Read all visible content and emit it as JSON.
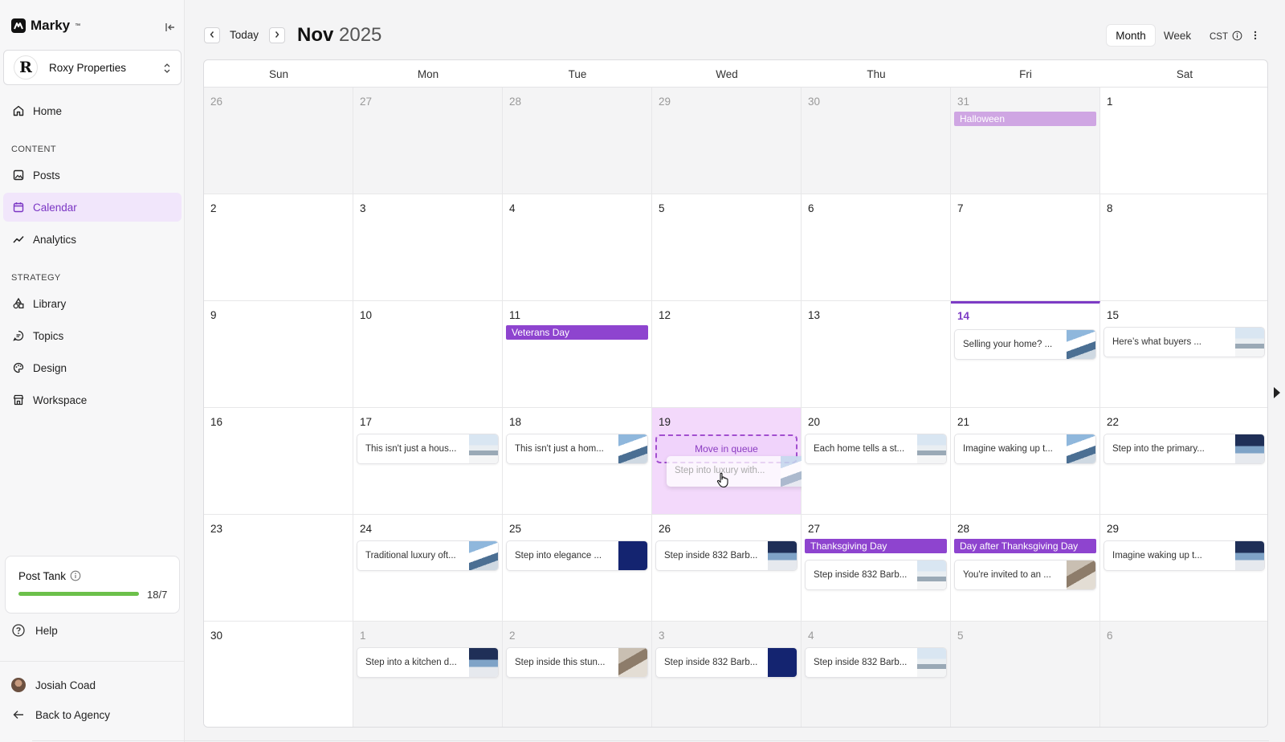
{
  "app": {
    "name": "Marky",
    "trademark": "™"
  },
  "brand": {
    "initial": "R",
    "name": "Roxy Properties"
  },
  "nav": {
    "home": "Home",
    "content_label": "CONTENT",
    "posts": "Posts",
    "calendar": "Calendar",
    "analytics": "Analytics",
    "strategy_label": "STRATEGY",
    "library": "Library",
    "topics": "Topics",
    "design": "Design",
    "workspace": "Workspace"
  },
  "post_tank": {
    "title": "Post Tank",
    "count": "18/7",
    "fill_fraction": 1.0
  },
  "footer": {
    "help": "Help",
    "user": "Josiah Coad",
    "back": "Back to Agency"
  },
  "header": {
    "today": "Today",
    "month": "Nov",
    "year": "2025",
    "view_month": "Month",
    "view_week": "Week",
    "timezone": "CST"
  },
  "colors": {
    "accent": "#7d3cc5",
    "holiday_light": "#cfa6e3",
    "holiday": "#8e44cf",
    "progress": "#6cc04a",
    "highlight": "#f3d9fb"
  },
  "calendar": {
    "weekdays": [
      "Sun",
      "Mon",
      "Tue",
      "Wed",
      "Thu",
      "Fri",
      "Sat"
    ],
    "weeks": [
      [
        {
          "d": "26",
          "out": true
        },
        {
          "d": "27",
          "out": true
        },
        {
          "d": "28",
          "out": true
        },
        {
          "d": "29",
          "out": true
        },
        {
          "d": "30",
          "out": true
        },
        {
          "d": "31",
          "out": true,
          "holiday": {
            "label": "Halloween",
            "style": "light"
          }
        },
        {
          "d": "1"
        }
      ],
      [
        {
          "d": "2"
        },
        {
          "d": "3"
        },
        {
          "d": "4"
        },
        {
          "d": "5"
        },
        {
          "d": "6"
        },
        {
          "d": "7"
        },
        {
          "d": "8"
        }
      ],
      [
        {
          "d": "9"
        },
        {
          "d": "10"
        },
        {
          "d": "11",
          "holiday": {
            "label": "Veterans Day",
            "style": "dark"
          }
        },
        {
          "d": "12"
        },
        {
          "d": "13"
        },
        {
          "d": "14",
          "today": true,
          "post": {
            "text": "Selling your home? ...",
            "thumb": "t2"
          }
        },
        {
          "d": "15",
          "post": {
            "text": "Here’s what buyers ...",
            "thumb": "t1"
          }
        }
      ],
      [
        {
          "d": "16"
        },
        {
          "d": "17",
          "post": {
            "text": "This isn't just a hous...",
            "thumb": "t1"
          }
        },
        {
          "d": "18",
          "post": {
            "text": "This isn't just a hom...",
            "thumb": "t2"
          }
        },
        {
          "d": "19",
          "highlight": true,
          "queue": "Move in queue",
          "ghost": {
            "text": "Step into luxury with...",
            "thumb": "t2"
          }
        },
        {
          "d": "20",
          "post": {
            "text": "Each home tells a st...",
            "thumb": "t1"
          }
        },
        {
          "d": "21",
          "post": {
            "text": "Imagine waking up t...",
            "thumb": "t2"
          }
        },
        {
          "d": "22",
          "post": {
            "text": "Step into the primary...",
            "thumb": "t3"
          }
        }
      ],
      [
        {
          "d": "23"
        },
        {
          "d": "24",
          "post": {
            "text": "Traditional luxury oft...",
            "thumb": "t2"
          }
        },
        {
          "d": "25",
          "post": {
            "text": "Step into elegance ...",
            "thumb": "t4"
          }
        },
        {
          "d": "26",
          "post": {
            "text": "Step inside 832 Barb...",
            "thumb": "t3"
          }
        },
        {
          "d": "27",
          "holiday": {
            "label": "Thanksgiving Day",
            "style": "dark"
          },
          "post": {
            "text": "Step inside 832 Barb...",
            "thumb": "t1"
          }
        },
        {
          "d": "28",
          "holiday": {
            "label": "Day after Thanksgiving Day",
            "style": "dark"
          },
          "post": {
            "text": "You're invited to an ...",
            "thumb": "t5"
          }
        },
        {
          "d": "29",
          "post": {
            "text": "Imagine waking up t...",
            "thumb": "t3"
          }
        }
      ],
      [
        {
          "d": "30"
        },
        {
          "d": "1",
          "out": true,
          "post": {
            "text": "Step into a kitchen d...",
            "thumb": "t3"
          }
        },
        {
          "d": "2",
          "out": true,
          "post": {
            "text": "Step inside this stun...",
            "thumb": "t5"
          }
        },
        {
          "d": "3",
          "out": true,
          "post": {
            "text": "Step inside 832 Barb...",
            "thumb": "t4"
          }
        },
        {
          "d": "4",
          "out": true,
          "post": {
            "text": "Step inside 832 Barb...",
            "thumb": "t1"
          }
        },
        {
          "d": "5",
          "out": true
        },
        {
          "d": "6",
          "out": true
        }
      ]
    ]
  }
}
